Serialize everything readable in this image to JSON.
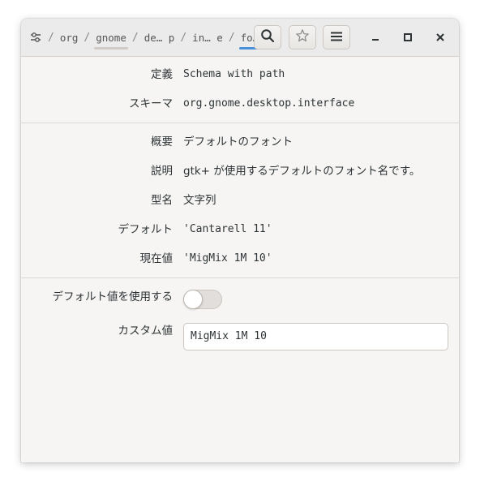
{
  "breadcrumb": {
    "root_icon": "settings-sliders-icon",
    "items": [
      "org",
      "gnome",
      "de… p",
      "in… e",
      "fo… e"
    ],
    "underline_color": "#4a90d9"
  },
  "header": {
    "search_icon": "search-icon",
    "bookmark_icon": "star-icon",
    "menu_icon": "hamburger-menu-icon",
    "minimize_icon": "minimize-icon",
    "maximize_icon": "maximize-icon",
    "close_icon": "close-icon"
  },
  "schema": {
    "definition_label": "定義",
    "definition_value": "Schema with path",
    "schema_label": "スキーマ",
    "schema_value": "org.gnome.desktop.interface"
  },
  "key": {
    "summary_label": "概要",
    "summary_value": "デフォルトのフォント",
    "description_label": "説明",
    "description_value": "gtk+ が使用するデフォルトのフォント名です。",
    "type_label": "型名",
    "type_value": "文字列",
    "default_label": "デフォルト",
    "default_value": "'Cantarell 11'",
    "current_label": "現在値",
    "current_value": "'MigMix 1M 10'"
  },
  "edit": {
    "use_default_label": "デフォルト値を使用する",
    "use_default_on": false,
    "custom_label": "カスタム値",
    "custom_value": "MigMix 1M 10"
  }
}
